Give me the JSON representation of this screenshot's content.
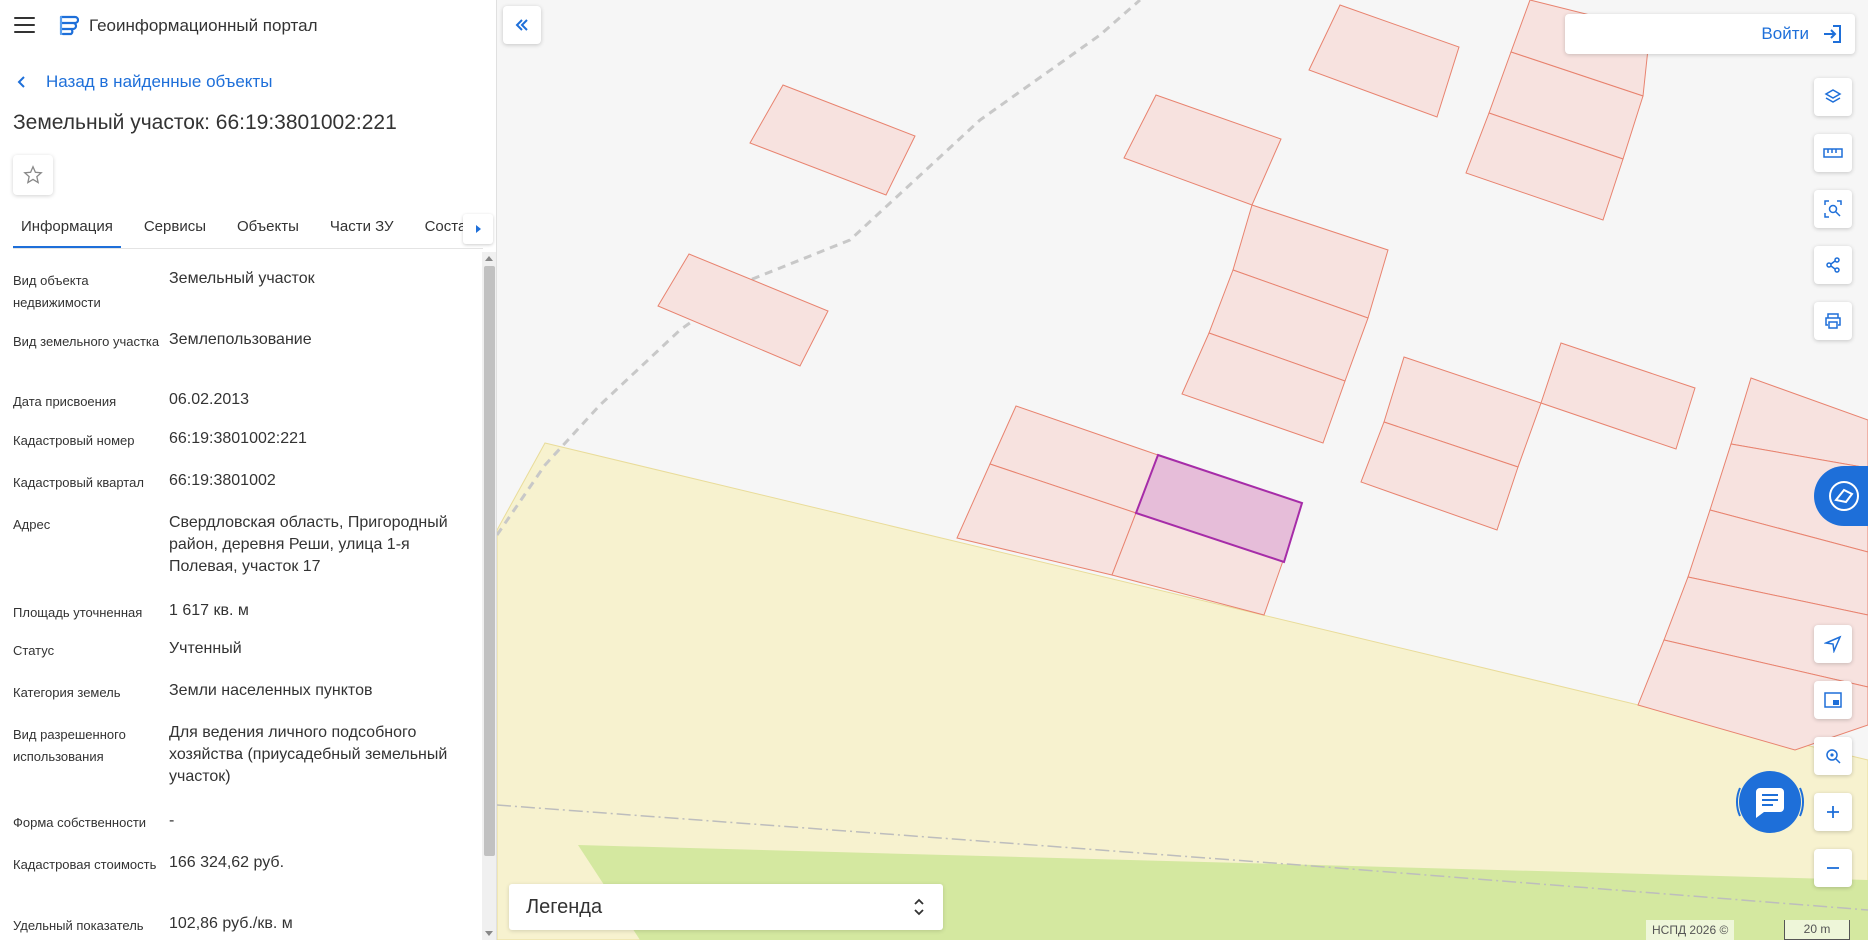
{
  "header": {
    "portal_title": "Геоинформационный портал",
    "menu_icon": "hamburger-menu-icon",
    "logo_icon": "portal-logo-icon"
  },
  "back_link": "Назад в найденные объекты",
  "object_title": "Земельный участок: 66:19:3801002:221",
  "tabs": [
    {
      "label": "Информация",
      "active": true
    },
    {
      "label": "Сервисы"
    },
    {
      "label": "Объекты"
    },
    {
      "label": "Части ЗУ"
    },
    {
      "label": "Состав"
    }
  ],
  "info": [
    {
      "label": "Вид объекта недвижимости",
      "value": "Земельный участок"
    },
    {
      "label": "Вид земельного участка",
      "value": "Землепользование"
    },
    {
      "label": "Дата присвоения",
      "value": "06.02.2013"
    },
    {
      "label": "Кадастровый номер",
      "value": "66:19:3801002:221"
    },
    {
      "label": "Кадастровый квартал",
      "value": "66:19:3801002"
    },
    {
      "label": "Адрес",
      "value": "Свердловская область, Пригородный район, деревня Реши, улица 1-я Полевая, участок 17"
    },
    {
      "label": "Площадь уточненная",
      "value": "1 617 кв. м"
    },
    {
      "label": "Статус",
      "value": "Учтенный"
    },
    {
      "label": "Категория земель",
      "value": "Земли населенных пунктов"
    },
    {
      "label": "Вид разрешенного использования",
      "value": "Для ведения личного подсобного хозяйства (приусадебный земельный участок)"
    },
    {
      "label": "Форма собственности",
      "value": "-"
    },
    {
      "label": "Кадастровая стоимость",
      "value": "166 324,62 руб."
    },
    {
      "label": "Удельный показатель",
      "value": "102,86 руб./кв. м"
    }
  ],
  "map": {
    "login_label": "Войти",
    "legend_label": "Легенда",
    "copyright": "НСПД 2026 ©",
    "scale_label": "20 m",
    "colors": {
      "parcel_fill": "#f7e2df",
      "parcel_stroke": "#e8836f",
      "selected_fill": "#e6bdd9",
      "selected_stroke": "#a62ca8",
      "zone_fill": "#f7f2cf",
      "green_fill": "#d4e8a0",
      "accent": "#1e6fd9"
    },
    "tools": [
      "layers-icon",
      "ruler-icon",
      "area-search-icon",
      "share-icon",
      "print-icon",
      "navigation-icon",
      "minimap-icon",
      "locate-icon",
      "zoom-in-icon",
      "zoom-out-icon"
    ]
  }
}
